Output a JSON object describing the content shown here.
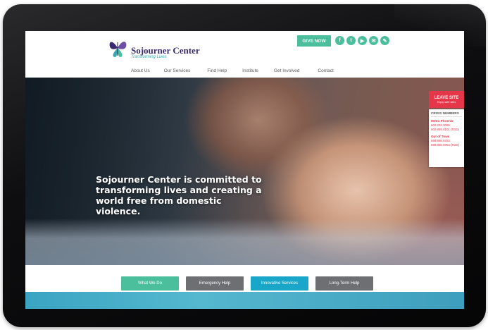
{
  "site": {
    "name": "Sojourner Center",
    "tagline": "Transforming Lives"
  },
  "header": {
    "give_now": "GIVE NOW",
    "social": [
      {
        "icon": "facebook-icon",
        "glyph": "f"
      },
      {
        "icon": "twitter-icon",
        "glyph": "t"
      },
      {
        "icon": "youtube-icon",
        "glyph": "▶"
      },
      {
        "icon": "email-icon",
        "glyph": "✉"
      },
      {
        "icon": "pencil-icon",
        "glyph": "✎"
      }
    ]
  },
  "nav": {
    "items": [
      "About Us",
      "Our Services",
      "Find Help",
      "Institute",
      "Get Involved",
      "Contact"
    ]
  },
  "hero": {
    "headline": "Sojourner Center is committed to transforming lives and creating a world free from domestic violence."
  },
  "leave_site": {
    "title": "LEAVE SITE",
    "subtitle": "Enjoy safe sites"
  },
  "crisis": {
    "title": "CRISIS NUMBERS",
    "metro": {
      "label": "Metro Phoenix",
      "phone": "602.244.0089",
      "tdd": "602.889.6101 (TDD)"
    },
    "out_of_town": {
      "label": "Out of Town",
      "phone": "888.888.8753",
      "tdd": "888.888.8754 (TDD)"
    }
  },
  "cta": {
    "what_we_do": "What We Do",
    "emergency_help": "Emergency Help",
    "innovative_services": "Innovative Services",
    "long_term_help": "Long-Term Help"
  },
  "colors": {
    "accent_green": "#4bbf9c",
    "accent_blue": "#1aa6c8",
    "alert_red": "#e5364a",
    "brand_purple": "#3a2a6e"
  }
}
